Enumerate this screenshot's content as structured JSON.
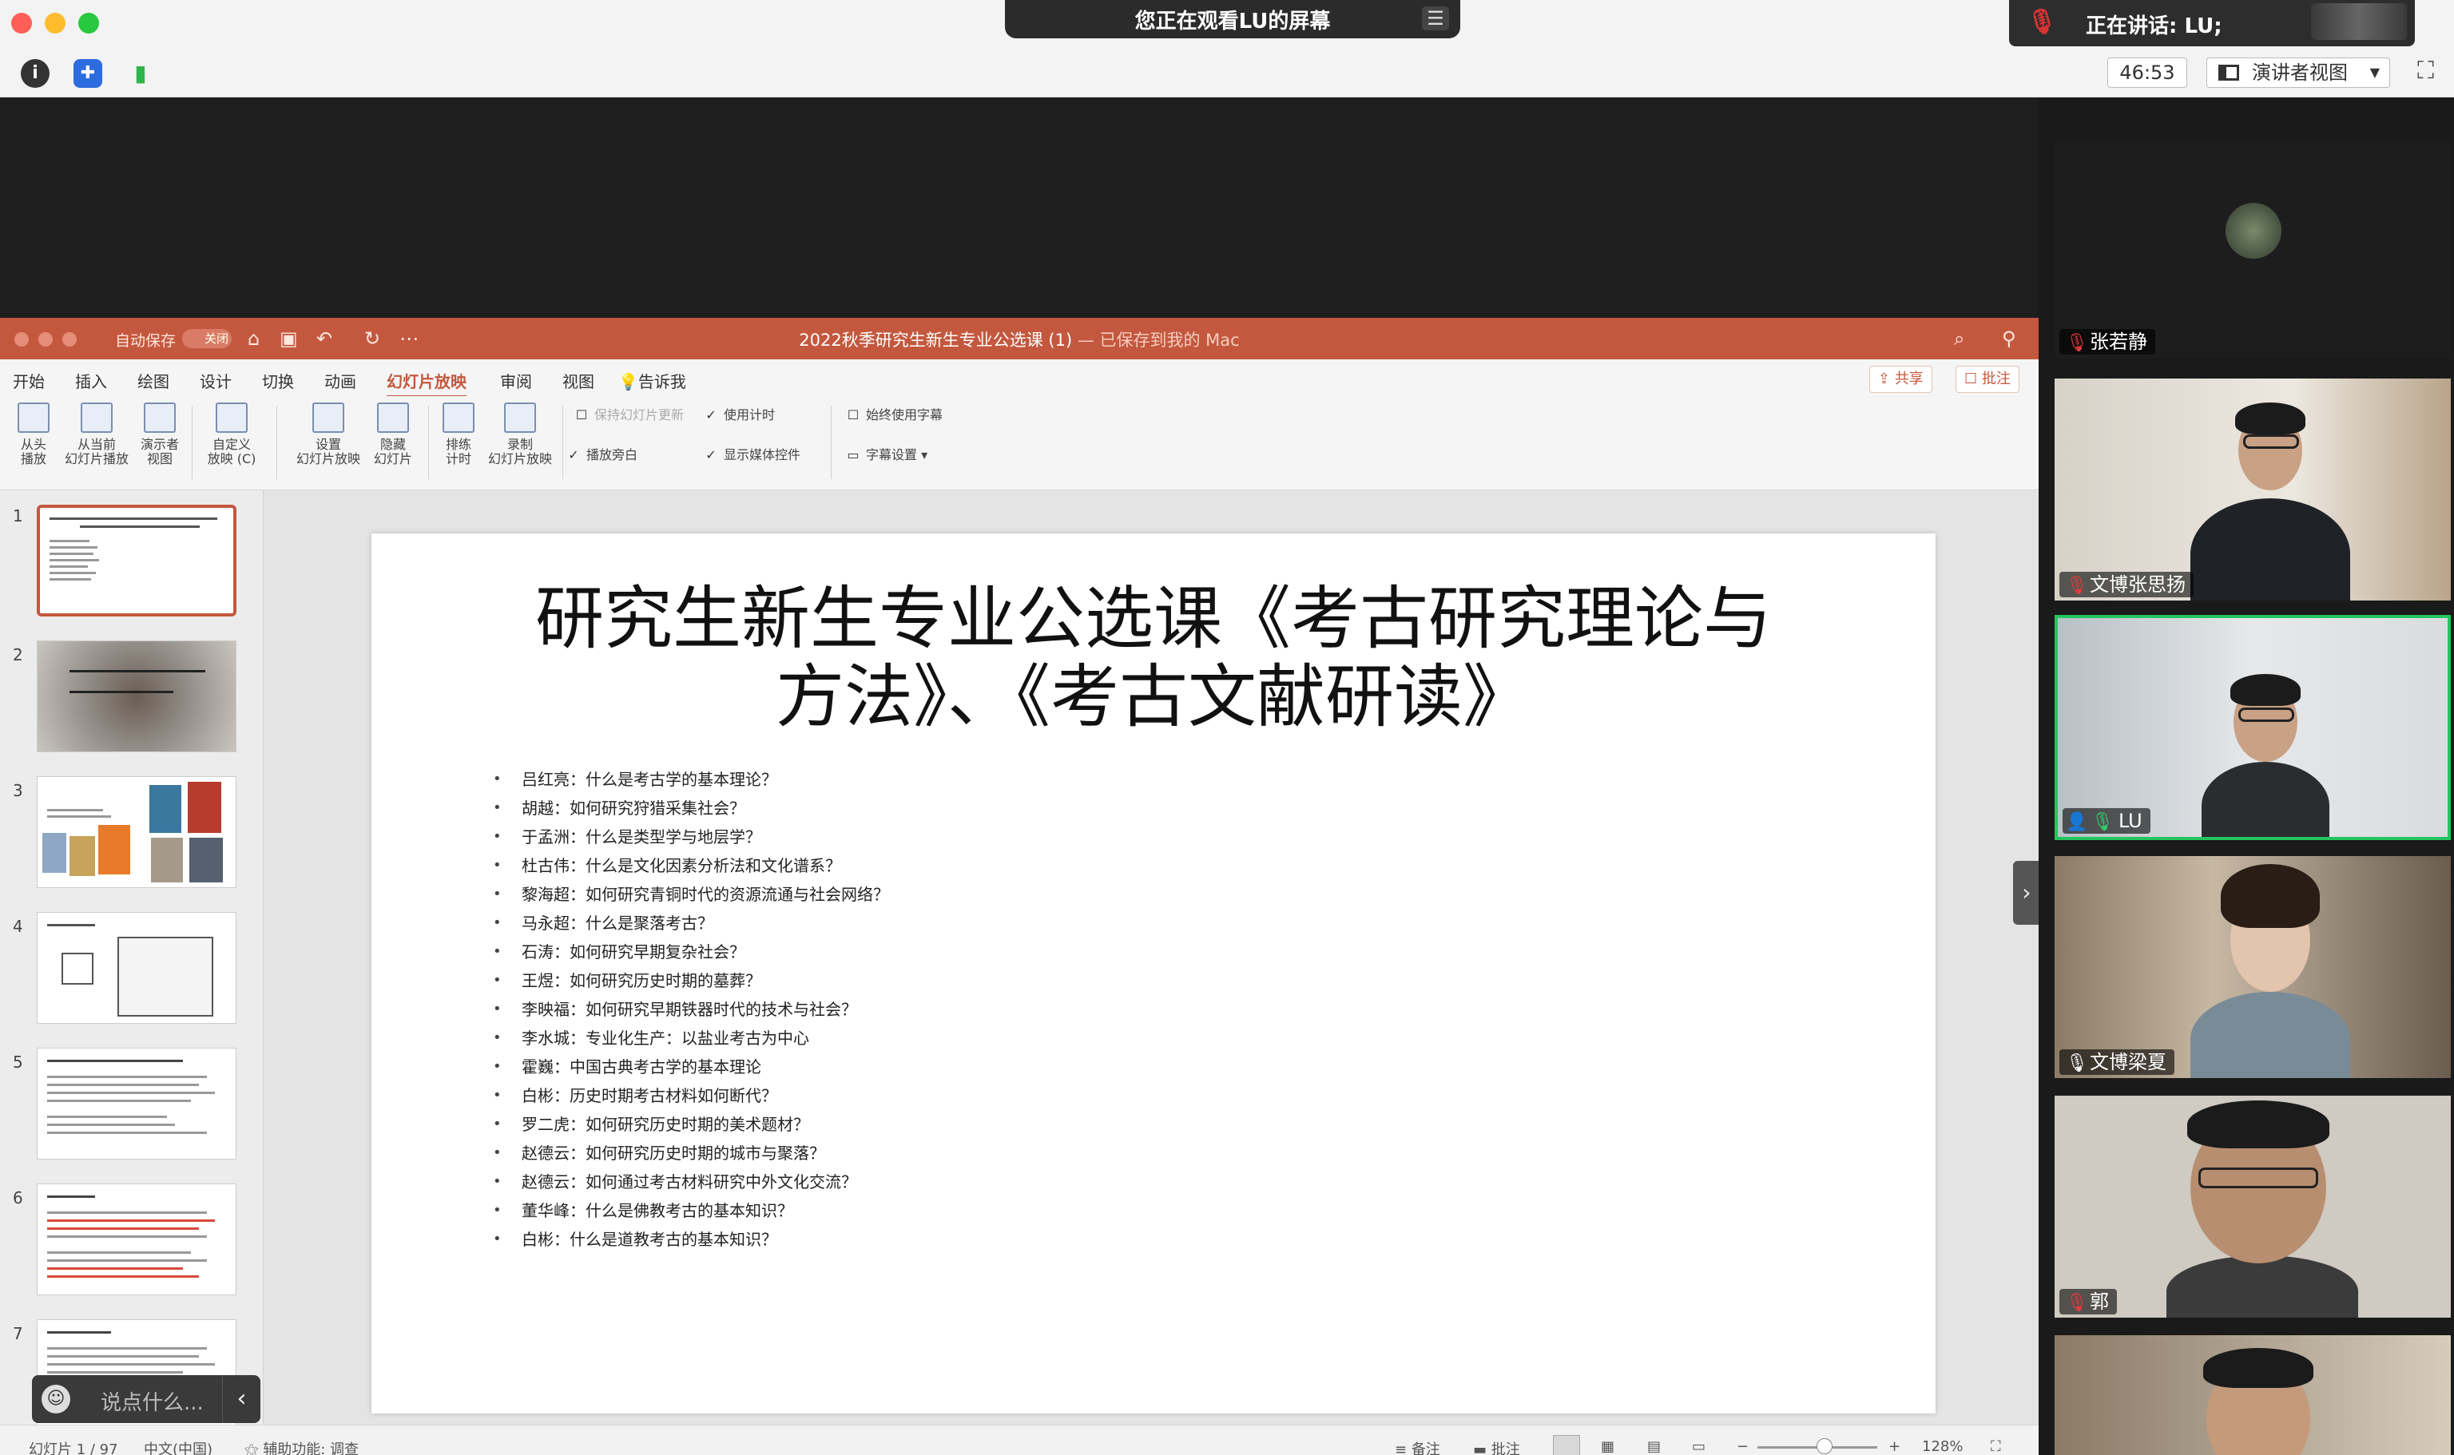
{
  "zoom": {
    "share_banner": "您正在观看LU的屏幕",
    "speaking": "正在讲话: LU;",
    "timer": "46:53",
    "view_mode": "演讲者视图",
    "colors": {
      "green": "#23c55e",
      "muted": "#e03b3b"
    }
  },
  "ppt": {
    "autosave_label": "自动保存",
    "autosave_state": "关闭",
    "doc_title": "2022秋季研究生新生专业公选课 (1)",
    "doc_saved": " — 已保存到我的 Mac",
    "tabs": [
      "开始",
      "插入",
      "绘图",
      "设计",
      "切换",
      "动画",
      "幻灯片放映",
      "审阅",
      "视图",
      "告诉我"
    ],
    "share": "共享",
    "comment": "批注",
    "ribbon": {
      "from_start": "从头\n播放",
      "from_current": "从当前\n幻灯片播放",
      "presenter_view": "演示者\n视图",
      "custom_show": "自定义\n放映 (C)",
      "setup_show": "设置\n幻灯片放映",
      "hide_slide": "隐藏\n幻灯片",
      "rehearse": "排练\n计时",
      "record": "录制\n幻灯片放映",
      "keep_updated": "保持幻灯片更新",
      "play_narration": "播放旁白",
      "use_timings": "使用计时",
      "show_media_controls": "显示媒体控件",
      "always_subtitles": "始终使用字幕",
      "subtitle_settings": "字幕设置"
    },
    "slide_numbers": [
      "1",
      "2",
      "3",
      "4",
      "5",
      "6",
      "7"
    ],
    "slide": {
      "title_line1": "研究生新生专业公选课《考古研究理论与",
      "title_line2": "方法》、《考古文献研读》",
      "items": [
        "吕红亮：什么是考古学的基本理论？",
        "胡越：如何研究狩猎采集社会？",
        "于孟洲：什么是类型学与地层学？",
        "杜古伟：什么是文化因素分析法和文化谱系？",
        "黎海超：如何研究青铜时代的资源流通与社会网络？",
        "马永超：什么是聚落考古？",
        "石涛：如何研究早期复杂社会？",
        "王煜：如何研究历史时期的墓葬？",
        "李映福：如何研究早期铁器时代的技术与社会？",
        "李水城：专业化生产：以盐业考古为中心",
        "霍巍：中国古典考古学的基本理论",
        "白彬：历史时期考古材料如何断代？",
        "罗二虎：如何研究历史时期的美术题材？",
        "赵德云：如何研究历史时期的城市与聚落？",
        "赵德云：如何通过考古材料研究中外文化交流？",
        "董华峰：什么是佛教考古的基本知识？",
        "白彬：什么是道教考古的基本知识？"
      ]
    },
    "status": {
      "slide_pos": "幻灯片 1 / 97",
      "lang": "中文(中国)",
      "accessibility": "辅助功能: 调查",
      "notes": "备注",
      "comments": "批注",
      "zoom": "128%"
    }
  },
  "chat": {
    "placeholder": "说点什么..."
  },
  "participants": [
    {
      "name": "张若静"
    },
    {
      "name": "文博张思扬"
    },
    {
      "name": "LU"
    },
    {
      "name": "文博梁夏"
    },
    {
      "name": "郭"
    }
  ]
}
